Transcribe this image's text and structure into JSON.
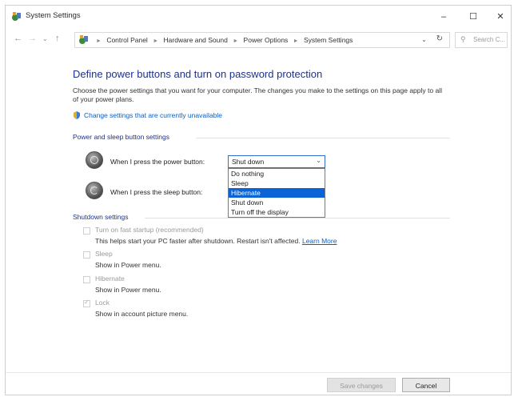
{
  "window": {
    "title": "System Settings",
    "controls": {
      "minimize": "–",
      "maximize": "☐",
      "close": "✕"
    }
  },
  "nav": {
    "back": "←",
    "forward": "→",
    "dropdown": "⌄",
    "up": "↑",
    "breadcrumb": [
      "Control Panel",
      "Hardware and Sound",
      "Power Options",
      "System Settings"
    ],
    "address_dropdown": "⌄",
    "refresh": "↻",
    "search_placeholder": "Search C..."
  },
  "page": {
    "title": "Define power buttons and turn on password protection",
    "description": "Choose the power settings that you want for your computer. The changes you make to the settings on this page apply to all of your power plans.",
    "change_link": "Change settings that are currently unavailable"
  },
  "power_section": {
    "heading": "Power and sleep button settings",
    "power_button_label": "When I press the power button:",
    "sleep_button_label": "When I press the sleep button:",
    "power_button_value": "Shut down",
    "options": [
      "Do nothing",
      "Sleep",
      "Hibernate",
      "Shut down",
      "Turn off the display"
    ],
    "highlighted_option": "Hibernate"
  },
  "shutdown_section": {
    "heading": "Shutdown settings",
    "items": [
      {
        "label": "Turn on fast startup (recommended)",
        "desc": "This helps start your PC faster after shutdown. Restart isn't affected.",
        "link": "Learn More",
        "checked": false
      },
      {
        "label": "Sleep",
        "desc": "Show in Power menu.",
        "checked": false
      },
      {
        "label": "Hibernate",
        "desc": "Show in Power menu.",
        "checked": false
      },
      {
        "label": "Lock",
        "desc": "Show in account picture menu.",
        "checked": true
      }
    ]
  },
  "footer": {
    "save_label": "Save changes",
    "cancel_label": "Cancel"
  },
  "colors": {
    "title_blue": "#1e3287",
    "link_blue": "#0b5fc4",
    "selection_blue": "#0a64d6"
  }
}
